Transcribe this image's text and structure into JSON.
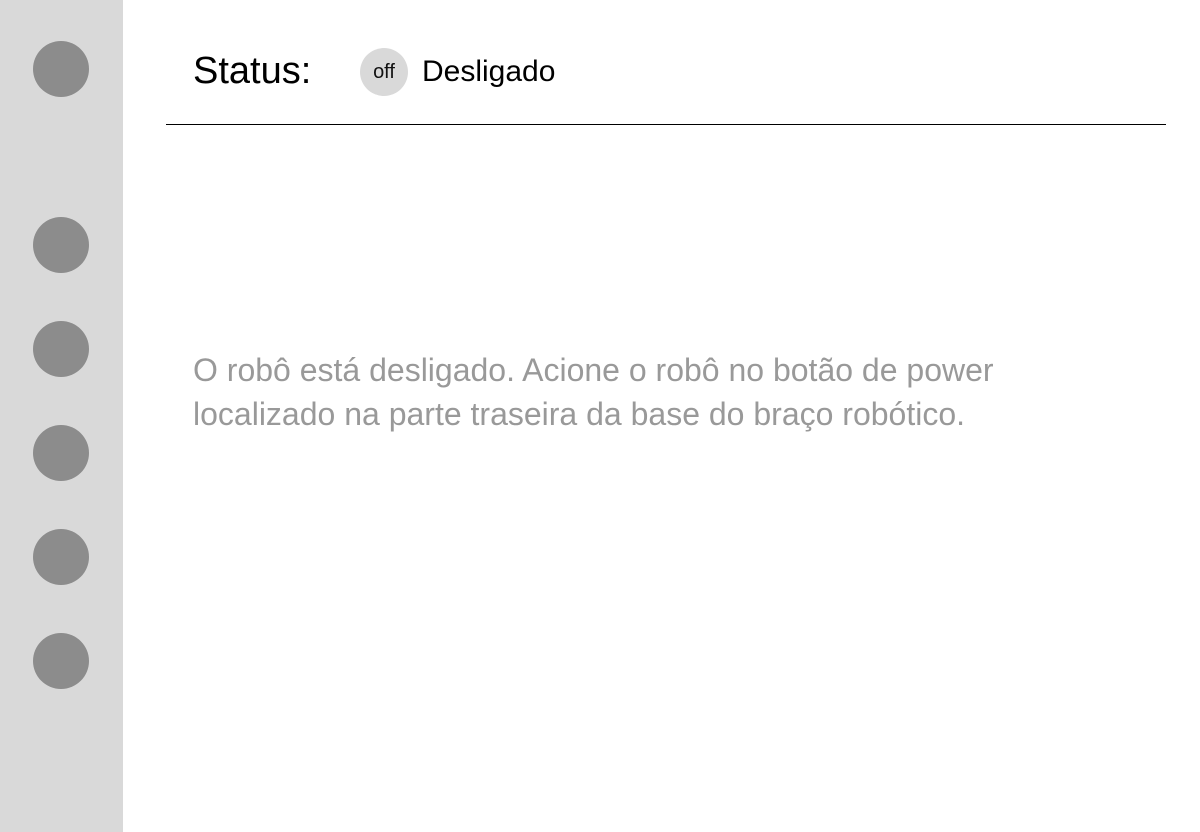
{
  "sidebar": {
    "items": [
      "nav-1",
      "nav-2",
      "nav-3",
      "nav-4",
      "nav-5",
      "nav-6"
    ]
  },
  "header": {
    "status_label": "Status:",
    "badge": "off",
    "status_text": "Desligado"
  },
  "main": {
    "message": "O robô está desligado. Acione o robô no botão de power localizado na parte traseira da base do braço robótico."
  },
  "colors": {
    "sidebar": "#d9d9d9",
    "nav_icon": "#8c8c8c",
    "message": "#999999"
  }
}
